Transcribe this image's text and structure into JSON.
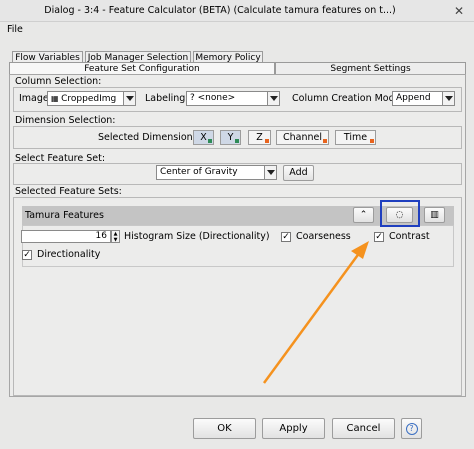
{
  "window": {
    "title": "Dialog - 3:4 - Feature Calculator (BETA) (Calculate tamura features on t...)",
    "close_glyph": "✕"
  },
  "menu": {
    "file": "File"
  },
  "tabs": {
    "top_row": [
      "Flow Variables",
      "Job Manager Selection",
      "Memory Policy"
    ],
    "bottom_row": [
      "Feature Set Configuration",
      "Segment Settings"
    ]
  },
  "column_selection": {
    "heading": "Column Selection:",
    "image_label": "Image",
    "image_value": "CroppedImg",
    "labeling_label": "Labeling",
    "labeling_value": "? <none>",
    "creation_mode_label": "Column Creation Mode",
    "creation_mode_value": "Append"
  },
  "dimension_selection": {
    "heading": "Dimension Selection:",
    "label": "Selected Dimensions",
    "dims": [
      {
        "label": "X",
        "selected": true,
        "color": "#2e8b57"
      },
      {
        "label": "Y",
        "selected": true,
        "color": "#2e8b57"
      },
      {
        "label": "Z",
        "selected": false,
        "color": "#e8641e"
      },
      {
        "label": "Channel",
        "selected": false,
        "color": "#e8641e"
      },
      {
        "label": "Time",
        "selected": false,
        "color": "#e8641e"
      }
    ]
  },
  "feature_set": {
    "heading": "Select Feature Set:",
    "value": "Center of Gravity",
    "add_label": "Add"
  },
  "selected_sets": {
    "heading": "Selected Feature Sets:",
    "set_title": "Tamura Features",
    "histogram_value": "16",
    "histogram_label": "Histogram Size (Directionality)",
    "options": [
      {
        "label": "Coarseness",
        "checked": true
      },
      {
        "label": "Contrast",
        "checked": true
      },
      {
        "label": "Directionality",
        "checked": true
      }
    ]
  },
  "buttons": {
    "ok": "OK",
    "apply": "Apply",
    "cancel": "Cancel",
    "help": "?"
  },
  "annotation": {
    "highlight_color": "#1f3fbf",
    "arrow_color": "#f5921e"
  }
}
